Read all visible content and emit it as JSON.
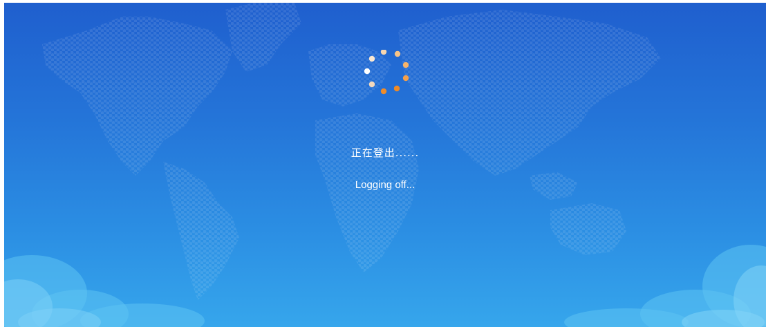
{
  "screen": {
    "status_primary": "正在登出......",
    "status_secondary": "Logging off..."
  },
  "spinner": {
    "icon": "loading-spinner-icon",
    "dot_colors": [
      "#f5a04a",
      "#f8b46a",
      "#f7c487",
      "#f6d6b0",
      "#fbe8d2",
      "#ffffff",
      "#f4d9bd",
      "#f0a24c",
      "#ee8c2a",
      "#ee8a26"
    ]
  },
  "theme": {
    "background_top": "#1f5fce",
    "background_bottom": "#36a6ec",
    "text_color": "#ffffff",
    "accent": "#ee8c2a"
  }
}
